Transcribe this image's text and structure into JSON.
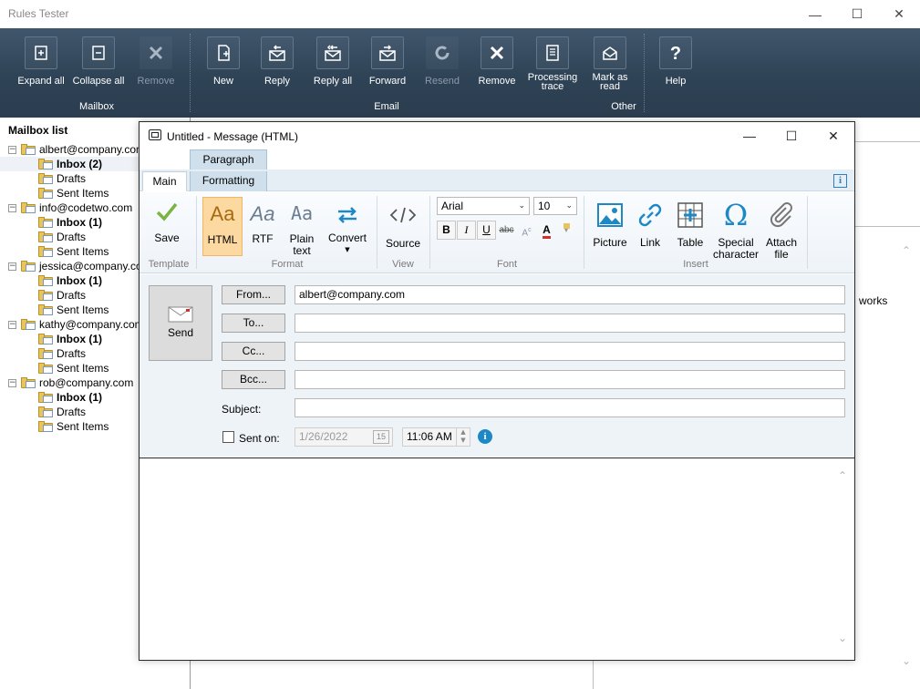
{
  "app": {
    "title": "Rules Tester",
    "controls": {
      "minimize": "—",
      "maximize": "☐",
      "close": "✕"
    }
  },
  "ribbon": {
    "buttons": {
      "expand_all": "Expand all",
      "collapse_all": "Collapse all",
      "remove_mailbox": "Remove",
      "new": "New",
      "reply": "Reply",
      "reply_all": "Reply all",
      "forward": "Forward",
      "resend": "Resend",
      "remove_email": "Remove",
      "processing_trace_1": "Processing",
      "processing_trace_2": "trace",
      "mark_as_read_1": "Mark as",
      "mark_as_read_2": "read",
      "help": "Help"
    },
    "groups": {
      "mailbox": "Mailbox",
      "email": "Email",
      "other": "Other"
    }
  },
  "mailbox_list": {
    "header": "Mailbox list",
    "accounts": [
      {
        "name": "albert@company.com",
        "inbox": "Inbox (2)",
        "drafts": "Drafts",
        "sent": "Sent Items"
      },
      {
        "name": "info@codetwo.com",
        "inbox": "Inbox (1)",
        "drafts": "Drafts",
        "sent": "Sent Items"
      },
      {
        "name": "jessica@company.com",
        "inbox": "Inbox (1)",
        "drafts": "Drafts",
        "sent": "Sent Items"
      },
      {
        "name": "kathy@company.com",
        "inbox": "Inbox (1)",
        "drafts": "Drafts",
        "sent": "Sent Items"
      },
      {
        "name": "rob@company.com",
        "inbox": "Inbox (1)",
        "drafts": "Drafts",
        "sent": "Sent Items"
      }
    ]
  },
  "background_text": {
    "works": "works"
  },
  "dialog": {
    "title": "Untitled - Message (HTML)",
    "context_tab": "Paragraph",
    "tabs": {
      "main": "Main",
      "formatting": "Formatting"
    },
    "info_icon": "i",
    "ribbon": {
      "save": "Save",
      "html": "HTML",
      "rtf": "RTF",
      "plain_text_1": "Plain",
      "plain_text_2": "text",
      "convert": "Convert",
      "source": "Source",
      "font_name": "Arial",
      "font_size": "10",
      "bold": "B",
      "italic": "I",
      "underline": "U",
      "strike": "abc",
      "picture": "Picture",
      "link": "Link",
      "table": "Table",
      "special_char_1": "Special",
      "special_char_2": "character",
      "attach_1": "Attach",
      "attach_2": "file",
      "aa_glyph": "Aa",
      "groups": {
        "template": "Template",
        "format": "Format",
        "view": "View",
        "font": "Font",
        "insert": "Insert"
      }
    },
    "compose": {
      "send": "Send",
      "from_btn": "From...",
      "to_btn": "To...",
      "cc_btn": "Cc...",
      "bcc_btn": "Bcc...",
      "from_value": "albert@company.com",
      "to_value": "",
      "cc_value": "",
      "bcc_value": "",
      "subject_label": "Subject:",
      "subject_value": "",
      "sent_on_label": "Sent on:",
      "sent_on_checked": false,
      "date_value": "1/26/2022",
      "calendar_day": "15",
      "time_value": "11:06 AM"
    }
  }
}
